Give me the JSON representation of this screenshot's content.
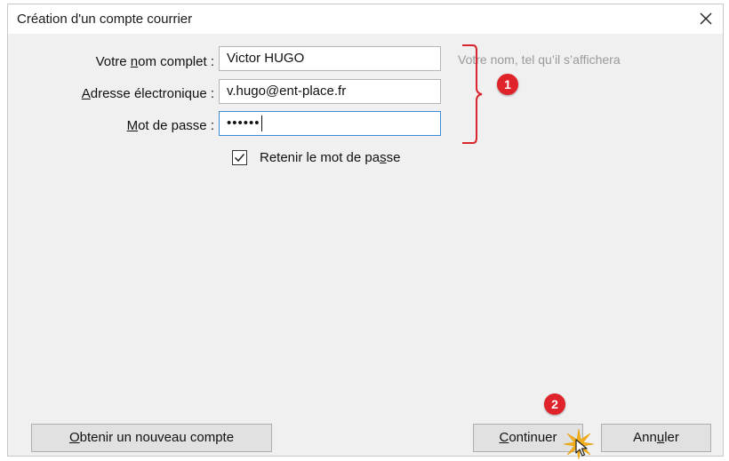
{
  "dialog": {
    "title": "Création d'un compte courrier",
    "close_icon": "close-icon"
  },
  "form": {
    "name_label_pre": "Votre ",
    "name_label_ul": "n",
    "name_label_post": "om complet :",
    "name_value": "Victor HUGO",
    "email_label_ul": "A",
    "email_label_post": "dresse électronique :",
    "email_value": "v.hugo@ent-place.fr",
    "password_label_ul": "M",
    "password_label_post": "ot de passe :",
    "password_value": "••••••",
    "name_hint": "Votre nom, tel qu’il s’affichera",
    "remember_checked": true,
    "remember_label_pre": "Retenir le mot de pa",
    "remember_label_ul": "s",
    "remember_label_post": "se"
  },
  "annotations": {
    "badge_1": "1",
    "badge_2": "2",
    "accent_color": "#e0232a"
  },
  "buttons": {
    "new_account_ul": "O",
    "new_account_post": "btenir un nouveau compte",
    "continue_ul": "C",
    "continue_post": "ontinuer",
    "cancel_pre": "Ann",
    "cancel_ul": "u",
    "cancel_post": "ler"
  }
}
